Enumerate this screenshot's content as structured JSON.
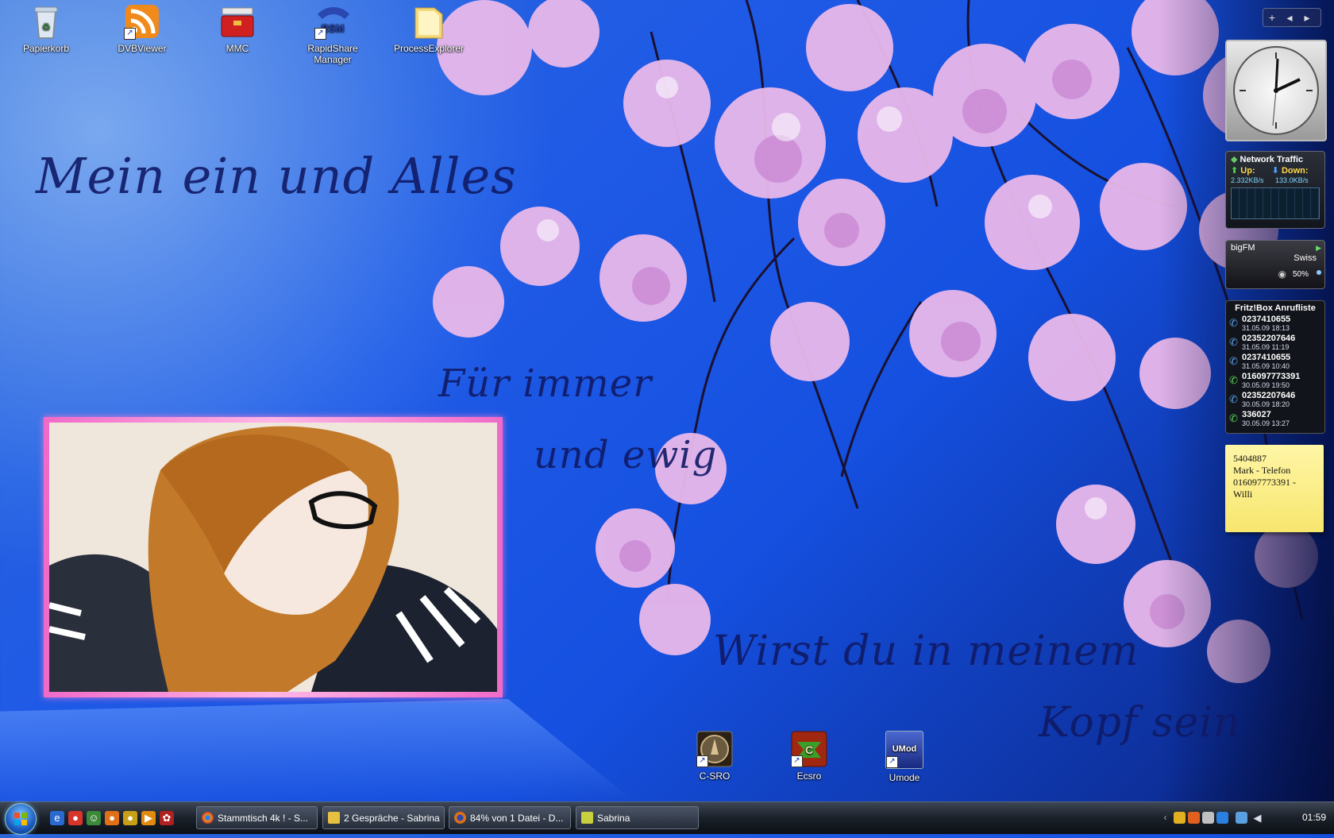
{
  "desktop_icons": [
    {
      "label": "Papierkorb",
      "icon": "recycle-bin-icon",
      "color": "#c9d8e8"
    },
    {
      "label": "DVBViewer",
      "icon": "rss-icon",
      "color": "#f08a1a"
    },
    {
      "label": "MMC",
      "icon": "toolbox-icon",
      "color": "#d02020"
    },
    {
      "label": "RapidShare Manager",
      "icon": "rsm-icon",
      "color": "#2a48b0"
    },
    {
      "label": "ProcessExplorer",
      "icon": "folder-icon",
      "color": "#e8c860"
    }
  ],
  "bottom_icons": [
    {
      "label": "C-SRO",
      "icon": "game-icon",
      "color": "#403020"
    },
    {
      "label": "Ecsro",
      "icon": "ecsro-icon",
      "color": "#a02810"
    },
    {
      "label": "Umode",
      "icon": "umod-icon",
      "color": "#203a90",
      "icon_text": "UMod"
    }
  ],
  "wallpaper_text": {
    "line1": "Mein ein und Alles",
    "line2": "Für immer",
    "line3": "und ewig",
    "line4": "Wirst du in meinem",
    "line5": "Kopf sein"
  },
  "gadgets": {
    "toolbar": {
      "add": "+",
      "prev": "◂",
      "next": "▸"
    },
    "network": {
      "title": "Network Traffic",
      "up_label": "Up:",
      "down_label": "Down:",
      "up_value": "2.332KB/s",
      "down_value": "133.0KB/s"
    },
    "radio": {
      "station": "bigFM",
      "region": "Swiss",
      "volume": "50%"
    },
    "fritzbox": {
      "title": "Fritz!Box Anrufliste",
      "calls": [
        {
          "number": "0237410655",
          "datetime": "31.05.09 18:13",
          "kind": "incoming"
        },
        {
          "number": "02352207646",
          "datetime": "31.05.09 11:19",
          "kind": "incoming"
        },
        {
          "number": "0237410655",
          "datetime": "31.05.09 10:40",
          "kind": "incoming"
        },
        {
          "number": "016097773391",
          "datetime": "30.05.09 19:50",
          "kind": "outgoing"
        },
        {
          "number": "02352207646",
          "datetime": "30.05.09 18:20",
          "kind": "incoming"
        },
        {
          "number": "336027",
          "datetime": "30.05.09 13:27",
          "kind": "outgoing"
        }
      ]
    },
    "note": {
      "lines": [
        "5404887",
        "Mark - Telefon",
        "016097773391 -",
        "Willi"
      ]
    }
  },
  "taskbar": {
    "quicklaunch": [
      {
        "icon": "ie-icon",
        "color": "#2a6ad0",
        "glyph": "e"
      },
      {
        "icon": "chrome-icon",
        "color": "#d8342a",
        "glyph": "●"
      },
      {
        "icon": "messenger-icon",
        "color": "#3a8a3a",
        "glyph": "☺"
      },
      {
        "icon": "firefox-icon",
        "color": "#e07018",
        "glyph": "●"
      },
      {
        "icon": "chrome-icon",
        "color": "#c8a018",
        "glyph": "●"
      },
      {
        "icon": "media-icon",
        "color": "#e08a10",
        "glyph": "▶"
      },
      {
        "icon": "tool-icon",
        "color": "#b02020",
        "glyph": "✿"
      }
    ],
    "tasks": [
      {
        "label": "Stammtisch 4k ! - S...",
        "icon": "chrome-icon",
        "color": "#e0a020"
      },
      {
        "label": "2 Gespräche - Sabrina",
        "icon": "chat-icon",
        "color": "#e8c040"
      },
      {
        "label": "84% von 1 Datei - D...",
        "icon": "firefox-icon",
        "color": "#e07018"
      },
      {
        "label": "Sabrina",
        "icon": "note-icon",
        "color": "#c8d040"
      }
    ],
    "tray_icons": [
      {
        "icon": "arrow-icon",
        "color": "#9aa"
      },
      {
        "icon": "tray-app-icon",
        "color": "#e0b020"
      },
      {
        "icon": "tray-app-icon",
        "color": "#e06020"
      },
      {
        "icon": "tray-app-icon",
        "color": "#c0c0c0"
      },
      {
        "icon": "tray-app-icon",
        "color": "#2a80e0"
      },
      {
        "icon": "network-icon",
        "color": "#5aa0e0"
      },
      {
        "icon": "volume-icon",
        "color": "#dde"
      }
    ],
    "time": "01:59"
  }
}
